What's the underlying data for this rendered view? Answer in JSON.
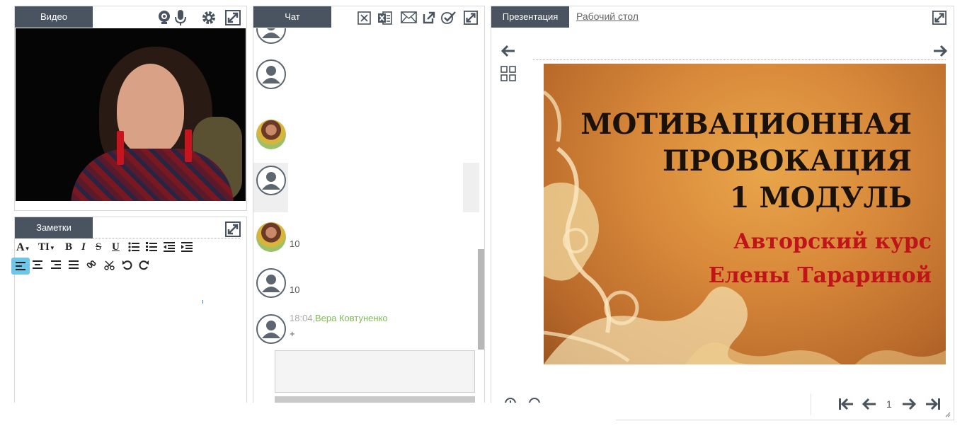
{
  "video_panel": {
    "tab_label": "Видео"
  },
  "notes_panel": {
    "tab_label": "Заметки",
    "toolbar": {
      "font_btn": "A",
      "size_btn": "TI",
      "bold": "B",
      "italic": "I",
      "strike": "S",
      "underline": "U"
    }
  },
  "chat_panel": {
    "tab_label": "Чат",
    "messages": [
      {
        "text": "10"
      },
      {
        "text": "10"
      },
      {
        "time": "18:04,",
        "author": "Вера Ковтуненко",
        "text": "+"
      }
    ]
  },
  "presentation_panel": {
    "tab_label": "Презентация",
    "desktop_tab_label": "Рабочий стол",
    "page_number": "1",
    "slide": {
      "title_lines": [
        "МОТИВАЦИОННАЯ",
        "ПРОВОКАЦИЯ",
        "1 МОДУЛЬ"
      ],
      "subtitle_lines": [
        "Авторский курс",
        "Елены Тарариной"
      ]
    }
  },
  "colors": {
    "tab_bg": "#4a5461",
    "author_green": "#7dbb57",
    "slide_title": "#1a1208",
    "slide_subtitle": "#c0141a",
    "active_align": "#6ec6e8"
  }
}
